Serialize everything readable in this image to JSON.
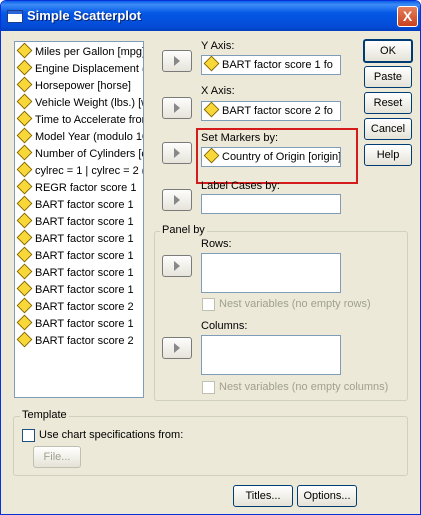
{
  "window": {
    "title": "Simple Scatterplot",
    "close_label": "X"
  },
  "variables": [
    "Miles per Gallon [mpg]",
    "Engine Displacement (",
    "Horsepower [horse]",
    "Vehicle Weight (lbs.) [w",
    "Time to Accelerate fror",
    "Model Year (modulo 10",
    "Number of Cylinders [c",
    "cylrec = 1 | cylrec = 2 (",
    "REGR factor score   1",
    "BART factor score   1",
    "BART factor score   1",
    "BART factor score   1",
    "BART factor score   1",
    "BART factor score   1",
    "BART factor score   1",
    "BART factor score   2",
    "BART factor score   1",
    "BART factor score   2"
  ],
  "y_axis": {
    "label": "Y Axis:",
    "value": "BART factor score   1 fo"
  },
  "x_axis": {
    "label": "X Axis:",
    "value": "BART factor score   2 fo"
  },
  "markers": {
    "label": "Set Markers by:",
    "value": "Country of Origin [origin]"
  },
  "label_cases": {
    "label": "Label Cases by:",
    "value": ""
  },
  "panel": {
    "title": "Panel by",
    "rows_label": "Rows:",
    "rows_nest": "Nest variables (no empty rows)",
    "columns_label": "Columns:",
    "columns_nest": "Nest variables (no empty columns)"
  },
  "buttons": {
    "ok": "OK",
    "paste": "Paste",
    "reset": "Reset",
    "cancel": "Cancel",
    "help": "Help",
    "titles": "Titles...",
    "options": "Options..."
  },
  "template": {
    "title": "Template",
    "checkbox_label": "Use chart specifications from:",
    "file_button": "File..."
  }
}
